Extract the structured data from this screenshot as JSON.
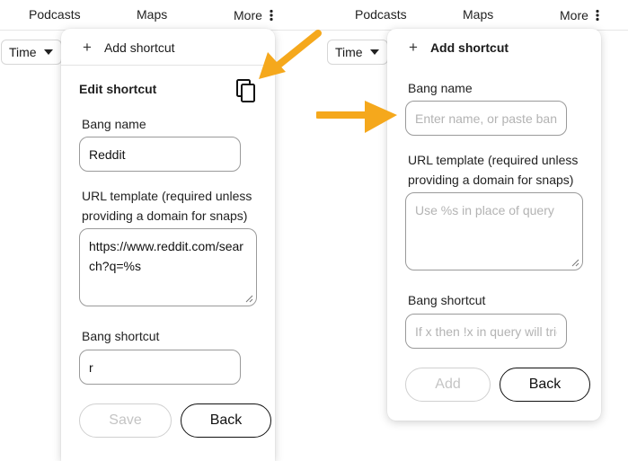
{
  "nav": {
    "podcasts": "Podcasts",
    "maps": "Maps",
    "more": "More",
    "time_filter": "Time"
  },
  "left_panel": {
    "add_shortcut": "Add shortcut",
    "title": "Edit shortcut",
    "bang_name_label": "Bang name",
    "bang_name_value": "Reddit",
    "url_label": "URL template (required unless providing a domain for snaps)",
    "url_value": "https://www.reddit.com/search?q=%s",
    "shortcut_label": "Bang shortcut",
    "shortcut_value": "r",
    "save_label": "Save",
    "back_label": "Back"
  },
  "right_panel": {
    "add_shortcut": "Add shortcut",
    "bang_name_label": "Bang name",
    "bang_name_placeholder": "Enter name, or paste bang",
    "url_label": "URL template (required unless providing a domain for snaps)",
    "url_placeholder": "Use %s in place of query",
    "shortcut_label": "Bang shortcut",
    "shortcut_placeholder": "If x then !x in query will trigger",
    "add_label": "Add",
    "back_label": "Back"
  },
  "colors": {
    "arrow": "#f5a81c",
    "border": "#9a9a9a",
    "disabled_text": "#c4c4c4"
  },
  "icons": [
    "copy-icon",
    "plus-icon",
    "more-dots-icon",
    "caret-down-icon",
    "arrow-pointer"
  ]
}
